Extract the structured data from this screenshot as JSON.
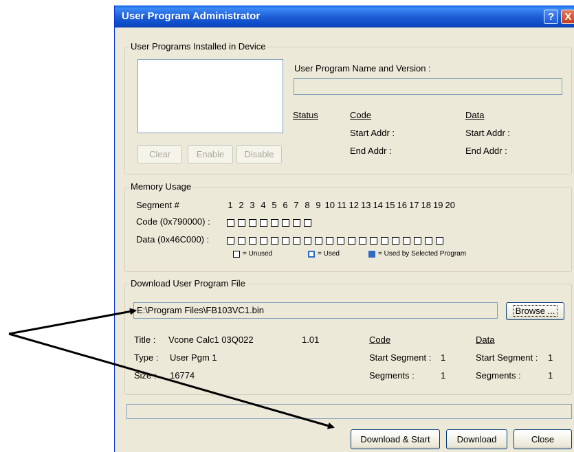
{
  "window": {
    "title": "User Program Administrator",
    "help_glyph": "?",
    "close_glyph": "X"
  },
  "installed": {
    "legend": "User Programs Installed in Device",
    "name_label": "User Program Name and Version :",
    "name_value": "",
    "status_label": "Status",
    "code_label": "Code",
    "data_label": "Data",
    "code_start": "Start Addr :",
    "code_end": "End Addr :",
    "data_start": "Start Addr :",
    "data_end": "End Addr :",
    "buttons": {
      "clear": "Clear",
      "enable": "Enable",
      "disable": "Disable"
    }
  },
  "memory": {
    "legend": "Memory Usage",
    "segment_label": "Segment #",
    "segments": [
      "1",
      "2",
      "3",
      "4",
      "5",
      "6",
      "7",
      "8",
      "9",
      "10",
      "11",
      "12",
      "13",
      "14",
      "15",
      "16",
      "17",
      "18",
      "19",
      "20"
    ],
    "code_label": "Code (0x790000) :",
    "code_segment_count": 8,
    "data_label": "Data (0x46C000) :",
    "data_segment_count": 20,
    "key_unused": "= Unused",
    "key_used": "= Used",
    "key_selected": "= Used by Selected Program",
    "used_color": "#316ac5"
  },
  "download": {
    "legend": "Download User Program File",
    "file_path": "E:\\Program Files\\FB103VC1.bin",
    "browse": "Browse ...",
    "title_label": "Title :",
    "title_value": "Vcone Calc1  03Q022",
    "version": "1.01",
    "type_label": "Type :",
    "type_value": "User Pgm 1",
    "size_label": "Size :",
    "size_value": "16774",
    "code_label": "Code",
    "data_label": "Data",
    "code_start_label": "Start Segment :",
    "code_start_value": "1",
    "code_segments_label": "Segments :",
    "code_segments_value": "1",
    "data_start_label": "Start Segment :",
    "data_start_value": "1",
    "data_segments_label": "Segments :",
    "data_segments_value": "1"
  },
  "footer": {
    "progress": 0,
    "download_start": "Download & Start",
    "download": "Download",
    "close": "Close"
  }
}
